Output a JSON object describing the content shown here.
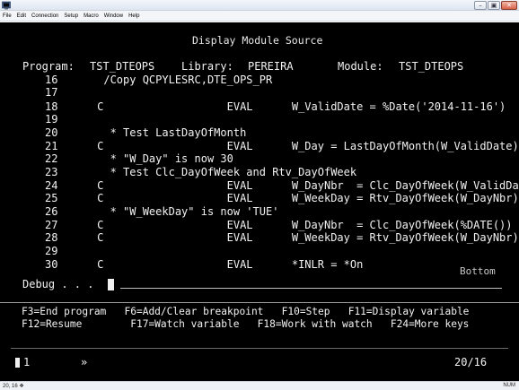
{
  "window": {
    "app_icon": "terminal-emulator-icon",
    "controls": [
      "minimize",
      "restore",
      "close"
    ]
  },
  "menu": [
    "File",
    "Edit",
    "Connection",
    "Setup",
    "Macro",
    "Window",
    "Help"
  ],
  "screen": {
    "title": "Display Module Source",
    "program_label": "Program:",
    "program_value": "TST_DTEOPS",
    "library_label": "Library:",
    "library_value": "PEREIRA",
    "module_label": "Module:",
    "module_value": "TST_DTEOPS",
    "source_lines": [
      {
        "num": "16",
        "text": "      /Copy QCPYLESRC,DTE_OPS_PR"
      },
      {
        "num": "17",
        "text": ""
      },
      {
        "num": "18",
        "text": "     C                   EVAL      W_ValidDate = %Date('2014-11-16')"
      },
      {
        "num": "19",
        "text": ""
      },
      {
        "num": "20",
        "text": "       * Test LastDayOfMonth"
      },
      {
        "num": "21",
        "text": "     C                   EVAL      W_Day = LastDayOfMonth(W_ValidDate)"
      },
      {
        "num": "22",
        "text": "       * \"W_Day\" is now 30"
      },
      {
        "num": "23",
        "text": "       * Test Clc_DayOfWeek and Rtv_DayOfWeek"
      },
      {
        "num": "24",
        "text": "     C                   EVAL      W_DayNbr  = Clc_DayOfWeek(W_ValidDa"
      },
      {
        "num": "25",
        "text": "     C                   EVAL      W_WeekDay = Rtv_DayOfWeek(W_DayNbr)"
      },
      {
        "num": "26",
        "text": "       * \"W_WeekDay\" is now 'TUE'"
      },
      {
        "num": "27",
        "text": "     C                   EVAL      W_DayNbr  = Clc_DayOfWeek(%DATE())"
      },
      {
        "num": "28",
        "text": "     C                   EVAL      W_WeekDay = Rtv_DayOfWeek(W_DayNbr)"
      },
      {
        "num": "29",
        "text": ""
      },
      {
        "num": "30",
        "text": "     C                   EVAL      *INLR = *On"
      }
    ],
    "bottom_indicator": "Bottom",
    "debug_label": "Debug . . .",
    "debug_value": "",
    "fkeys_row1": "F3=End program   F6=Add/Clear breakpoint   F10=Step   F11=Display variable",
    "fkeys_row2": "F12=Resume        F17=Watch variable   F18=Work with watch   F24=More keys",
    "session_number": "1",
    "session_arrow": "»",
    "cursor_position": "20/16"
  },
  "statusbar": {
    "left": "20, 16",
    "left_icon": "connection-icon",
    "right": "NUM"
  }
}
